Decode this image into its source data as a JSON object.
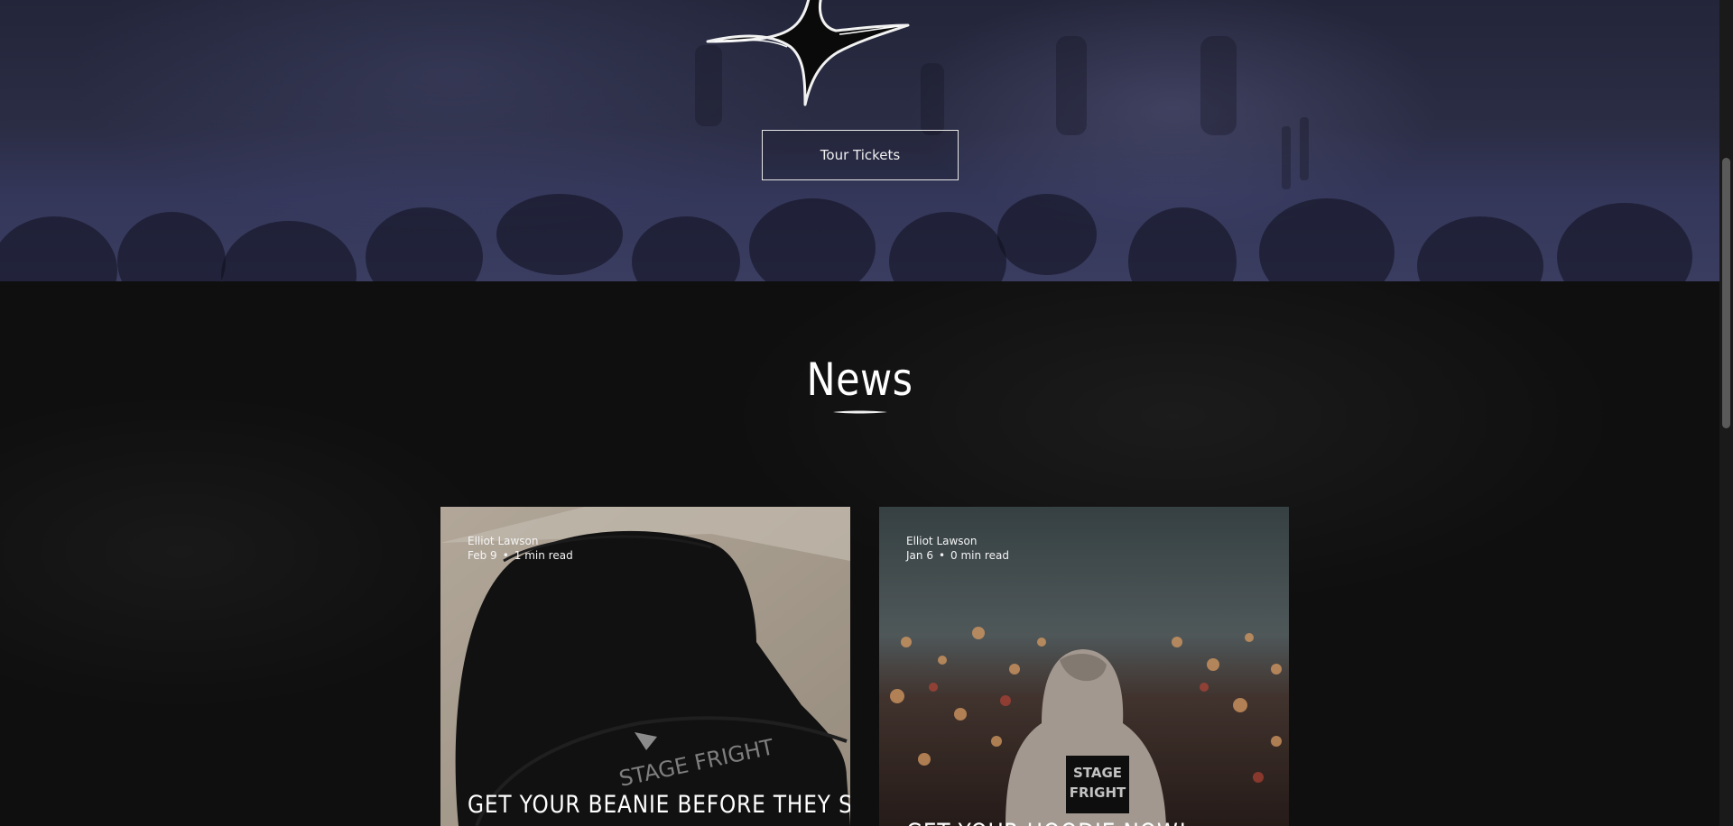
{
  "hero": {
    "button_label": "Tour Tickets",
    "logo_icon": "stage-fright-star-icon"
  },
  "news": {
    "title": "News",
    "posts": [
      {
        "author": "Elliot Lawson",
        "date": "Feb 9",
        "separator": "•",
        "read_time": "1 min read",
        "title": "GET YOUR BEANIE BEFORE THEY SELL",
        "image": "black-beanie-photo"
      },
      {
        "author": "Elliot Lawson",
        "date": "Jan 6",
        "separator": "•",
        "read_time": "0 min read",
        "title": "GET YOUR HOODIE NOW!",
        "image": "hoodie-city-lights-photo"
      }
    ]
  },
  "colors": {
    "background": "#0f0f0f",
    "hero_tint": "#2b2d45",
    "text": "#ffffff"
  }
}
